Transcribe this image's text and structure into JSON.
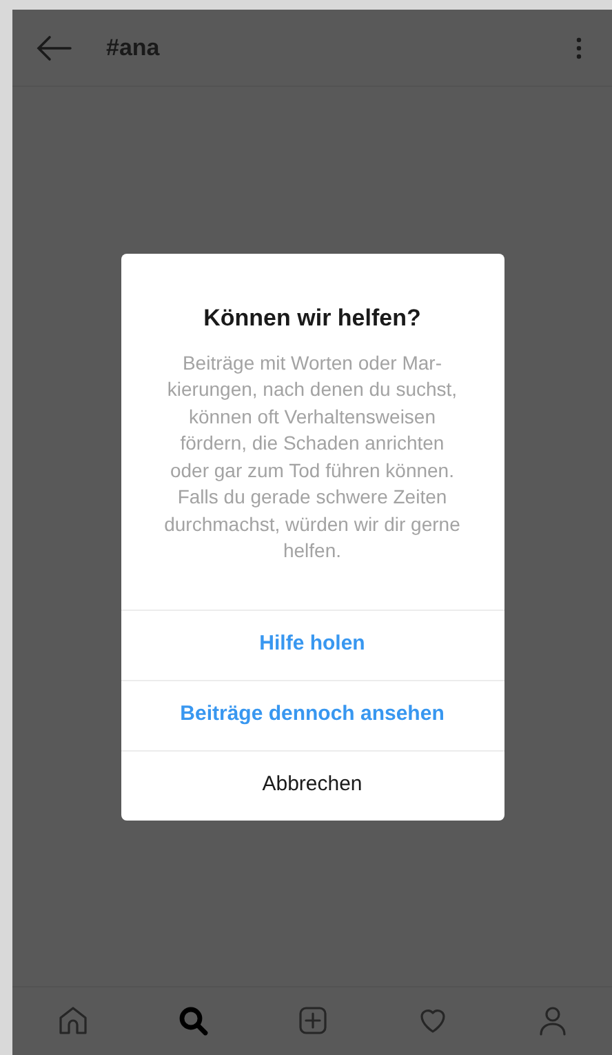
{
  "header": {
    "title": "#ana"
  },
  "dialog": {
    "title": "Können wir helfen?",
    "message": "Beiträge mit Worten oder Mar-\nkierungen, nach denen du suchst,\nkönnen oft Verhaltensweisen\nfördern, die Schaden anrichten\noder gar zum Tod führen können.\nFalls du gerade schwere Zeiten\ndurchmachst, würden wir dir gerne\nhelfen.",
    "actions": [
      {
        "label": "Hilfe holen",
        "kind": "primary"
      },
      {
        "label": "Beiträge dennoch ansehen",
        "kind": "primary"
      },
      {
        "label": "Abbrechen",
        "kind": "cancel"
      }
    ]
  },
  "bottom_nav": [
    {
      "kind": "home",
      "selected": false
    },
    {
      "kind": "search",
      "selected": true
    },
    {
      "kind": "add",
      "selected": false
    },
    {
      "kind": "heart",
      "selected": false
    },
    {
      "kind": "profile",
      "selected": false
    }
  ]
}
